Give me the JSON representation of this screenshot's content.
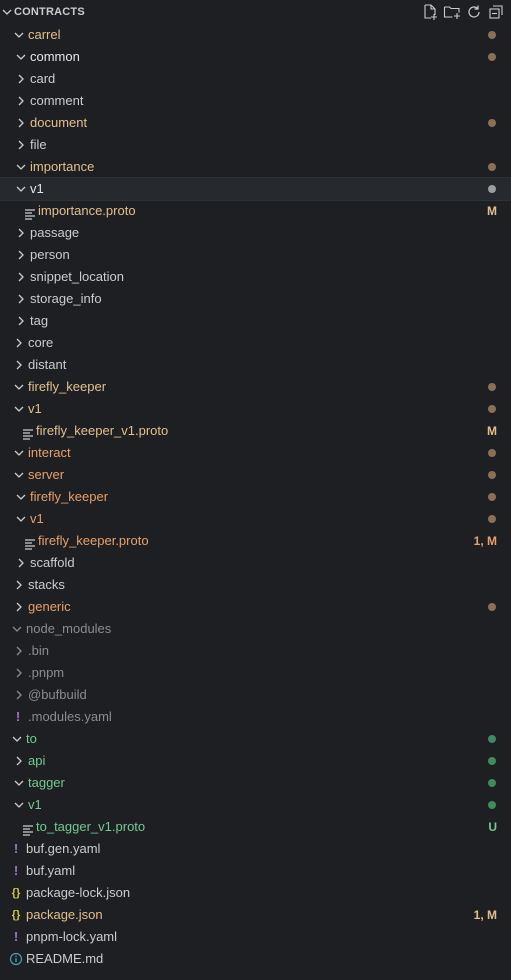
{
  "header": {
    "title": "CONTRACTS"
  },
  "colors": {
    "modified": "#e2c08d",
    "untracked": "#73c991",
    "ignored": "#8c8c8c",
    "problem": "#e7a06b",
    "dot_modified": "#8a7155",
    "dot_untracked": "#3e8b5c",
    "dot_selected": "#9d9d9d"
  },
  "tree": [
    {
      "label": "carrel",
      "depth": 0,
      "kind": "folder",
      "open": true,
      "status": "modified",
      "dot": true
    },
    {
      "label": "common",
      "depth": 1,
      "kind": "folder",
      "open": true,
      "status": "modified",
      "dot": true,
      "bright": true
    },
    {
      "label": "card",
      "depth": 1,
      "kind": "folder",
      "open": false,
      "status": "normal"
    },
    {
      "label": "comment",
      "depth": 1,
      "kind": "folder",
      "open": false,
      "status": "normal"
    },
    {
      "label": "document",
      "depth": 1,
      "kind": "folder",
      "open": false,
      "status": "modified",
      "dot": true
    },
    {
      "label": "file",
      "depth": 1,
      "kind": "folder",
      "open": false,
      "status": "normal"
    },
    {
      "label": "importance",
      "depth": 1,
      "kind": "folder",
      "open": true,
      "status": "modified",
      "dot": true
    },
    {
      "label": "v1",
      "depth": 1,
      "kind": "folder",
      "open": true,
      "status": "normal",
      "dot": true,
      "selected": true
    },
    {
      "label": "importance.proto",
      "depth": 2,
      "kind": "proto",
      "status": "modified",
      "badge": "M"
    },
    {
      "label": "passage",
      "depth": 1,
      "kind": "folder",
      "open": false,
      "status": "normal"
    },
    {
      "label": "person",
      "depth": 1,
      "kind": "folder",
      "open": false,
      "status": "normal"
    },
    {
      "label": "snippet_location",
      "depth": 1,
      "kind": "folder",
      "open": false,
      "status": "normal"
    },
    {
      "label": "storage_info",
      "depth": 1,
      "kind": "folder",
      "open": false,
      "status": "normal"
    },
    {
      "label": "tag",
      "depth": 1,
      "kind": "folder",
      "open": false,
      "status": "normal"
    },
    {
      "label": "core",
      "depth": 0,
      "kind": "folder",
      "open": false,
      "status": "normal"
    },
    {
      "label": "distant",
      "depth": 0,
      "kind": "folder",
      "open": false,
      "status": "normal"
    },
    {
      "label": "firefly_keeper",
      "depth": 0,
      "kind": "folder",
      "open": true,
      "status": "modified",
      "dot": true
    },
    {
      "label": "v1",
      "depth": 0,
      "kind": "folder",
      "open": true,
      "status": "modified",
      "dot": true
    },
    {
      "label": "firefly_keeper_v1.proto",
      "depth": 1,
      "kind": "proto",
      "status": "modified",
      "badge": "M"
    },
    {
      "label": "interact",
      "depth": 0,
      "kind": "folder",
      "open": true,
      "status": "problem",
      "dot": true
    },
    {
      "label": "server",
      "depth": 0,
      "kind": "folder",
      "open": true,
      "status": "problem",
      "dot": true
    },
    {
      "label": "firefly_keeper",
      "depth": 1,
      "kind": "folder",
      "open": true,
      "status": "problem",
      "dot": true
    },
    {
      "label": "v1",
      "depth": 1,
      "kind": "folder",
      "open": true,
      "status": "problem",
      "dot": true
    },
    {
      "label": "firefly_keeper.proto",
      "depth": 2,
      "kind": "proto",
      "status": "problem",
      "badge": "1, M"
    },
    {
      "label": "scaffold",
      "depth": 1,
      "kind": "folder",
      "open": false,
      "status": "normal"
    },
    {
      "label": "stacks",
      "depth": 0,
      "kind": "folder",
      "open": false,
      "status": "normal"
    },
    {
      "label": "generic",
      "depth": 0,
      "kind": "folder",
      "open": false,
      "status": "problem",
      "dot": true
    },
    {
      "label": "node_modules",
      "depth": -1,
      "kind": "folder",
      "open": true,
      "status": "ignored"
    },
    {
      "label": ".bin",
      "depth": 0,
      "kind": "folder",
      "open": false,
      "status": "ignored"
    },
    {
      "label": ".pnpm",
      "depth": 0,
      "kind": "folder",
      "open": false,
      "status": "ignored"
    },
    {
      "label": "@bufbuild",
      "depth": 0,
      "kind": "folder",
      "open": false,
      "status": "ignored"
    },
    {
      "label": ".modules.yaml",
      "depth": 0,
      "kind": "yaml",
      "status": "ignored"
    },
    {
      "label": "to",
      "depth": -1,
      "kind": "folder",
      "open": true,
      "status": "untracked",
      "dot": true
    },
    {
      "label": "api",
      "depth": 0,
      "kind": "folder",
      "open": false,
      "status": "untracked",
      "dot": true
    },
    {
      "label": "tagger",
      "depth": 0,
      "kind": "folder",
      "open": true,
      "status": "untracked",
      "dot": true
    },
    {
      "label": "v1",
      "depth": 0,
      "kind": "folder",
      "open": true,
      "status": "untracked",
      "dot": true
    },
    {
      "label": "to_tagger_v1.proto",
      "depth": 1,
      "kind": "proto",
      "status": "untracked",
      "badge": "U"
    },
    {
      "label": "buf.gen.yaml",
      "depth": -1,
      "kind": "yaml",
      "status": "normal"
    },
    {
      "label": "buf.yaml",
      "depth": -1,
      "kind": "yaml",
      "status": "normal"
    },
    {
      "label": "package-lock.json",
      "depth": -1,
      "kind": "json",
      "status": "normal"
    },
    {
      "label": "package.json",
      "depth": -1,
      "kind": "json",
      "status": "modified",
      "badge": "1, M"
    },
    {
      "label": "pnpm-lock.yaml",
      "depth": -1,
      "kind": "yaml",
      "status": "normal"
    },
    {
      "label": "README.md",
      "depth": -1,
      "kind": "info",
      "status": "normal"
    }
  ]
}
